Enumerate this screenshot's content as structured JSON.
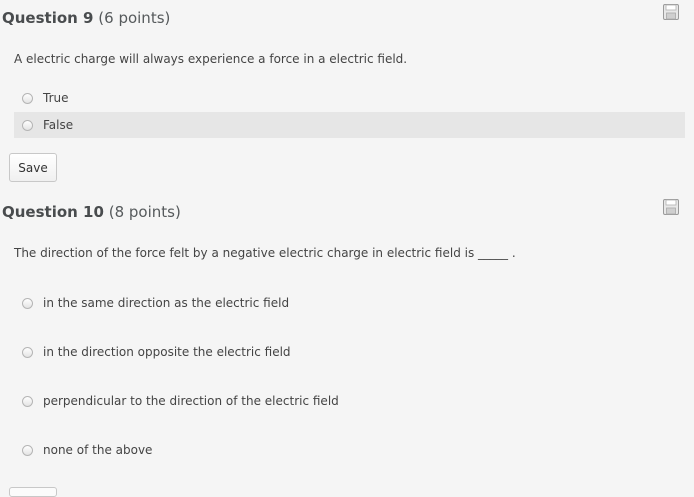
{
  "questions": [
    {
      "name": "Question 9",
      "points": "(6 points)",
      "text": "A electric charge will always experience a force in a electric field.",
      "options": [
        "True",
        "False"
      ],
      "save_label": "Save"
    },
    {
      "name": "Question 10",
      "points": "(8 points)",
      "text": "The direction of the force felt by a negative electric charge in electric field is _____ .",
      "options": [
        "in the same direction as the electric field",
        "in the direction opposite the electric field",
        "perpendicular to the direction of the electric field",
        "none of the above"
      ]
    }
  ],
  "icons": {
    "save_question": "floppy-disk-icon",
    "radio": "radio-button"
  },
  "colors": {
    "background": "#f5f5f5",
    "option_highlight": "#e6e6e6",
    "title": "#494c4e"
  }
}
